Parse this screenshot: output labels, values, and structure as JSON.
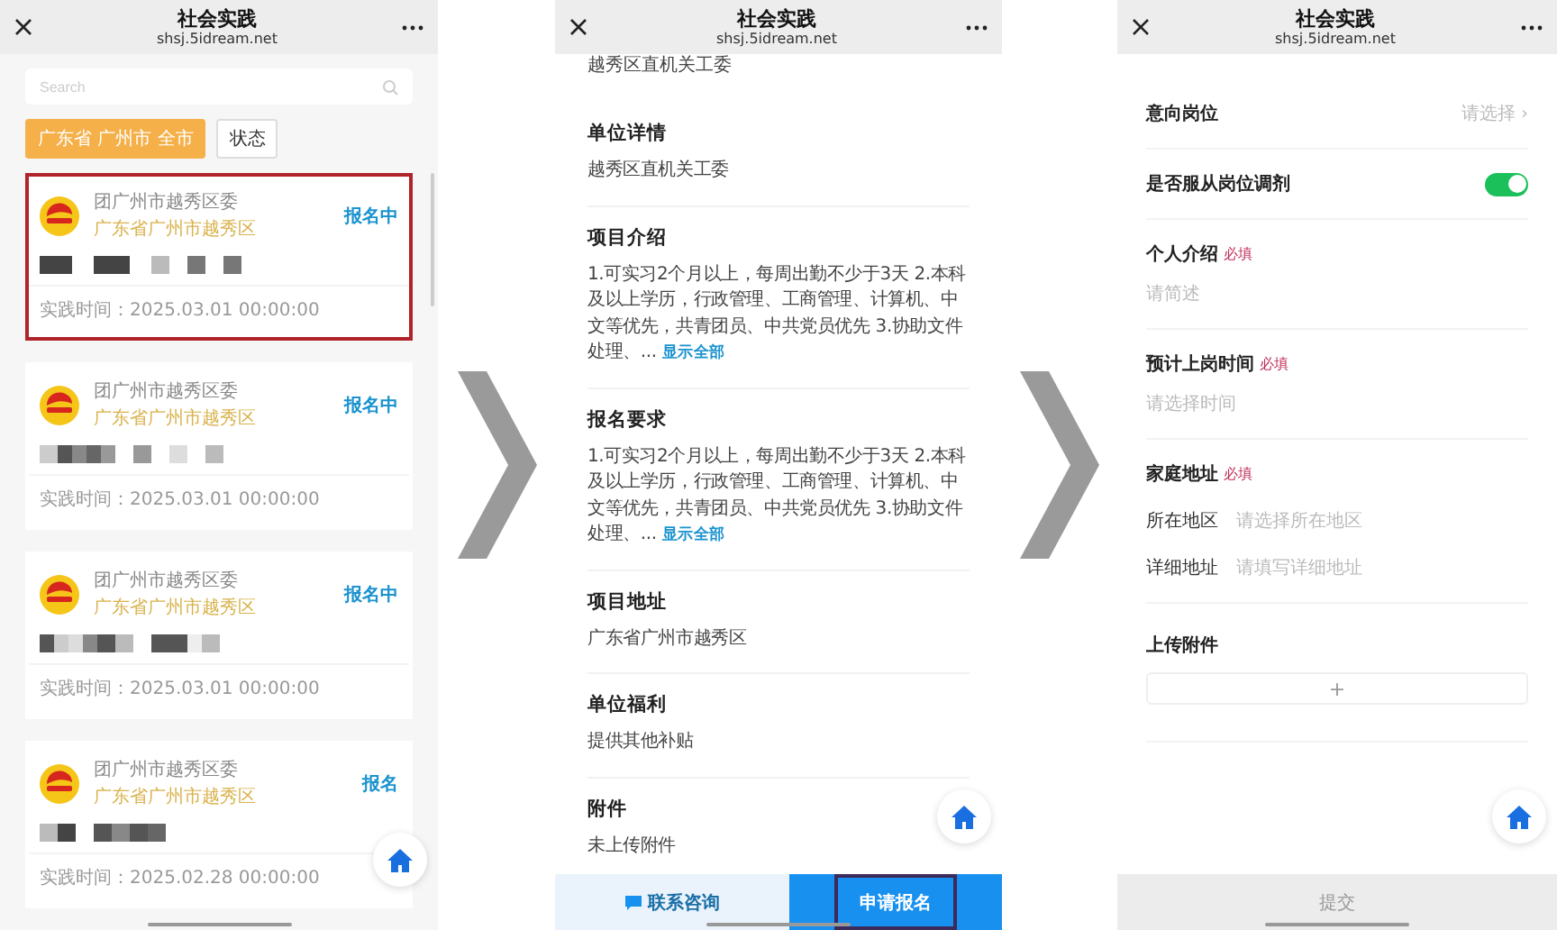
{
  "list_screen": {
    "header": {
      "title": "社会实践",
      "url": "shsj.5idream.net"
    },
    "search": {
      "placeholder": "Search"
    },
    "filters": [
      {
        "label": "广东省 广州市 全市",
        "selected": true
      },
      {
        "label": "状态",
        "selected": false
      }
    ],
    "cards": [
      {
        "org": "团广州市越秀区委",
        "location": "广东省广州市越秀区",
        "status": "报名中",
        "time": "实践时间：2025.03.01 00:00:00",
        "highlighted": true
      },
      {
        "org": "团广州市越秀区委",
        "location": "广东省广州市越秀区",
        "status": "报名中",
        "time": "实践时间：2025.03.01 00:00:00",
        "highlighted": false
      },
      {
        "org": "团广州市越秀区委",
        "location": "广东省广州市越秀区",
        "status": "报名中",
        "time": "实践时间：2025.03.01 00:00:00",
        "highlighted": false
      },
      {
        "org": "团广州市越秀区委",
        "location": "广东省广州市越秀区",
        "status": "报名",
        "time": "实践时间：2025.02.28 00:00:00",
        "highlighted": false
      }
    ]
  },
  "detail_screen": {
    "header": {
      "title": "社会实践",
      "url": "shsj.5idream.net"
    },
    "top_text": "越秀区直机关工委",
    "sections": [
      {
        "title": "单位详情",
        "text": "越秀区直机关工委"
      },
      {
        "title": "项目介绍",
        "text": "1.可实习2个月以上，每周出勤不少于3天 2.本科及以上学历，行政管理、工商管理、计算机、中文等优先，共青团员、中共党员优先 3.协助文件处理、...",
        "more": "显示全部"
      },
      {
        "title": "报名要求",
        "text": "1.可实习2个月以上，每周出勤不少于3天 2.本科及以上学历，行政管理、工商管理、计算机、中文等优先，共青团员、中共党员优先 3.协助文件处理、...",
        "more": "显示全部"
      },
      {
        "title": "项目地址",
        "text": "广东省广州市越秀区"
      },
      {
        "title": "单位福利",
        "text": "提供其他补贴"
      },
      {
        "title": "附件",
        "text": "未上传附件"
      }
    ],
    "contact_button": "联系咨询",
    "apply_button": {
      "label": "申请报名",
      "highlighted": true
    }
  },
  "form_screen": {
    "header": {
      "title": "社会实践",
      "url": "shsj.5idream.net"
    },
    "fields": [
      {
        "kind": "select",
        "label": "意向岗位",
        "placeholder": "请选择 ›"
      },
      {
        "kind": "toggle",
        "label": "是否服从岗位调剂",
        "on": true
      },
      {
        "kind": "textarea",
        "label": "个人介绍",
        "required_tag": "必填",
        "placeholder": "请简述"
      },
      {
        "kind": "picker",
        "label": "预计上岗时间",
        "required_tag": "必填",
        "placeholder": "请选择时间"
      },
      {
        "kind": "address",
        "label": "家庭地址",
        "required_tag": "必填",
        "rows": [
          {
            "label": "所在地区",
            "placeholder": "请选择所在地区"
          },
          {
            "label": "详细地址",
            "placeholder": "请填写详细地址"
          }
        ]
      },
      {
        "kind": "upload",
        "label": "上传附件",
        "button": "+"
      }
    ],
    "submit": "提交"
  }
}
